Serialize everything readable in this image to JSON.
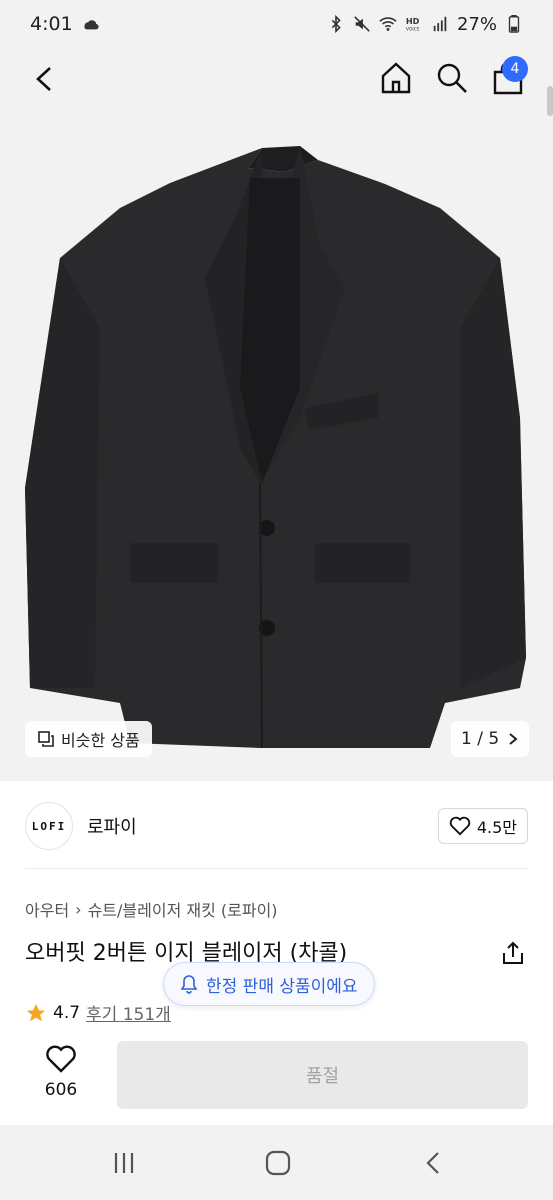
{
  "status_bar": {
    "time": "4:01",
    "battery": "27%",
    "icons": [
      "cloud-sync-icon",
      "bluetooth-icon",
      "mute-icon",
      "wifi-icon",
      "hd-voice-icon",
      "signal-icon",
      "battery-icon"
    ]
  },
  "appbar": {
    "icons": [
      "back-icon",
      "home-icon",
      "search-icon",
      "shopping-bag-icon"
    ],
    "cart_count": "4"
  },
  "gallery": {
    "similar_label": "비슷한 상품",
    "page_indicator": "1 / 5"
  },
  "brand": {
    "logo_text": "LOFI",
    "name": "로파이",
    "like_count": "4.5만"
  },
  "product": {
    "breadcrumb": [
      "아우터",
      "슈트/블레이저 재킷 (로파이)"
    ],
    "title": "오버핏 2버튼 이지 블레이저 (차콜)",
    "limited_tag": "한정 판매 상품이에요",
    "rating": "4.7",
    "reviews": "후기 151개"
  },
  "buy_bar": {
    "likes": "606",
    "soldout_label": "품절"
  },
  "colors": {
    "accent": "#2f6bff",
    "jacket": "#2a2a2c",
    "star": "#f5a623"
  }
}
